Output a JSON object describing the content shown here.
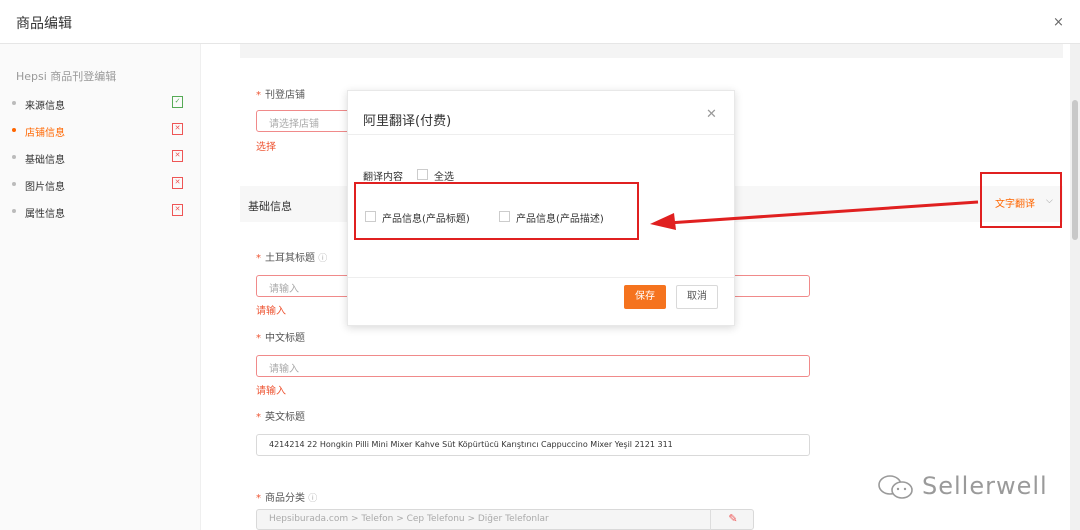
{
  "header": {
    "title": "商品编辑",
    "close": "×"
  },
  "sidebar": {
    "title": "Hepsi 商品刊登编辑",
    "items": [
      {
        "label": "来源信息",
        "status": "ok"
      },
      {
        "label": "店铺信息",
        "status": "error",
        "active": true
      },
      {
        "label": "基础信息",
        "status": "error"
      },
      {
        "label": "图片信息",
        "status": "error"
      },
      {
        "label": "属性信息",
        "status": "error"
      }
    ]
  },
  "form": {
    "store_label": "刊登店铺",
    "store_placeholder": "请选择店铺",
    "store_error": "选择",
    "section_title": "基础信息",
    "translate_btn": "文字翻译",
    "turkish_title_label": "土耳其标题",
    "turkish_title_placeholder": "请输入",
    "turkish_title_error": "请输入",
    "chinese_title_label": "中文标题",
    "chinese_title_placeholder": "请输入",
    "chinese_title_error": "请输入",
    "english_title_label": "英文标题",
    "english_title_value": "4214214 22 Hongkin Pilli Mini Mixer Kahve Süt Köpürtücü Karıştırıcı Cappuccino Mixer Yeşil 2121 311",
    "category_label": "商品分类",
    "category_value": "Hepsiburada.com > Telefon > Cep Telefonu > Diğer Telefonlar"
  },
  "modal": {
    "title": "阿里翻译(付费)",
    "content_label": "翻译内容",
    "select_all": "全选",
    "option_title": "产品信息(产品标题)",
    "option_desc": "产品信息(产品描述)",
    "save": "保存",
    "cancel": "取消"
  },
  "watermark": {
    "text": "Sellerwell"
  },
  "colors": {
    "accent": "#f5731e",
    "error": "#e53333",
    "highlight": "#e02020"
  }
}
